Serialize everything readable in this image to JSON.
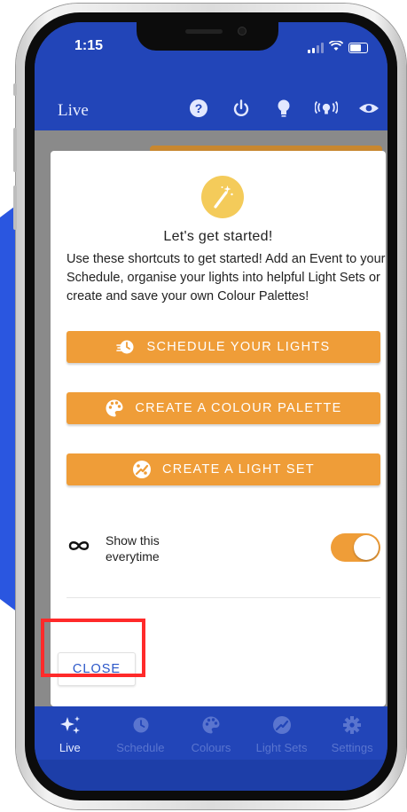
{
  "status_bar": {
    "time": "1:15"
  },
  "app_bar": {
    "title": "Live",
    "actions": [
      "help-icon",
      "power-icon",
      "bulb-icon",
      "broadcast-icon",
      "eye-icon"
    ]
  },
  "dialog": {
    "title": "Let's get started!",
    "body": "Use these shortcuts to get started! Add an Event to your Schedule, organise your lights into helpful Light Sets or create and save your own Colour Palettes!",
    "buttons": [
      {
        "label": "SCHEDULE YOUR LIGHTS",
        "icon": "schedule-icon"
      },
      {
        "label": "CREATE A COLOUR PALETTE",
        "icon": "palette-icon"
      },
      {
        "label": "CREATE A LIGHT SET",
        "icon": "light-set-icon"
      }
    ],
    "toggle": {
      "label": "Show this everytime",
      "on": true
    },
    "close_label": "CLOSE"
  },
  "bottom_nav": {
    "items": [
      {
        "label": "Live",
        "icon": "sparkles-icon",
        "active": true
      },
      {
        "label": "Schedule",
        "icon": "schedule-icon",
        "active": false
      },
      {
        "label": "Colours",
        "icon": "palette-icon",
        "active": false
      },
      {
        "label": "Light Sets",
        "icon": "light-set-icon",
        "active": false
      },
      {
        "label": "Settings",
        "icon": "gear-icon",
        "active": false
      }
    ]
  },
  "colors": {
    "primary": "#2245b8",
    "accent": "#ef9d38",
    "highlight": "#ff2a2a",
    "close_text": "#2a56c8"
  }
}
